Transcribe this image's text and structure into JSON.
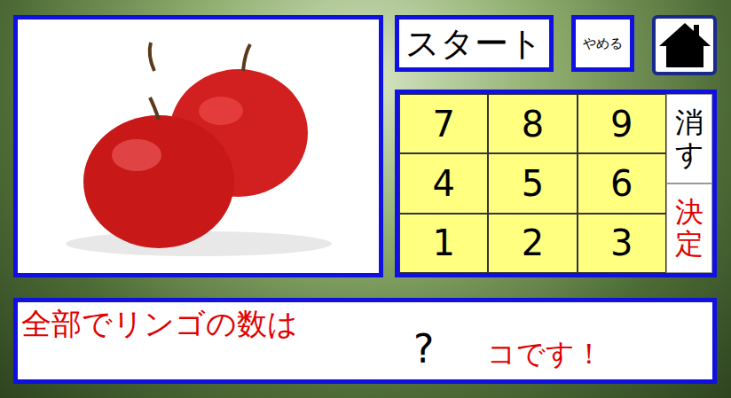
{
  "start_button": {
    "label": "スタート"
  },
  "stop_button": {
    "label": "やめる"
  },
  "keypad": {
    "keys": [
      "7",
      "8",
      "9",
      "4",
      "5",
      "6",
      "1",
      "2",
      "3"
    ],
    "side_keys": [
      {
        "label": "消す",
        "color": "#000000"
      },
      {
        "label": "決定",
        "color": "#e00000"
      }
    ]
  },
  "answer": {
    "prompt": "全部でリンゴの数は",
    "value": "?",
    "unit": "コです！"
  }
}
